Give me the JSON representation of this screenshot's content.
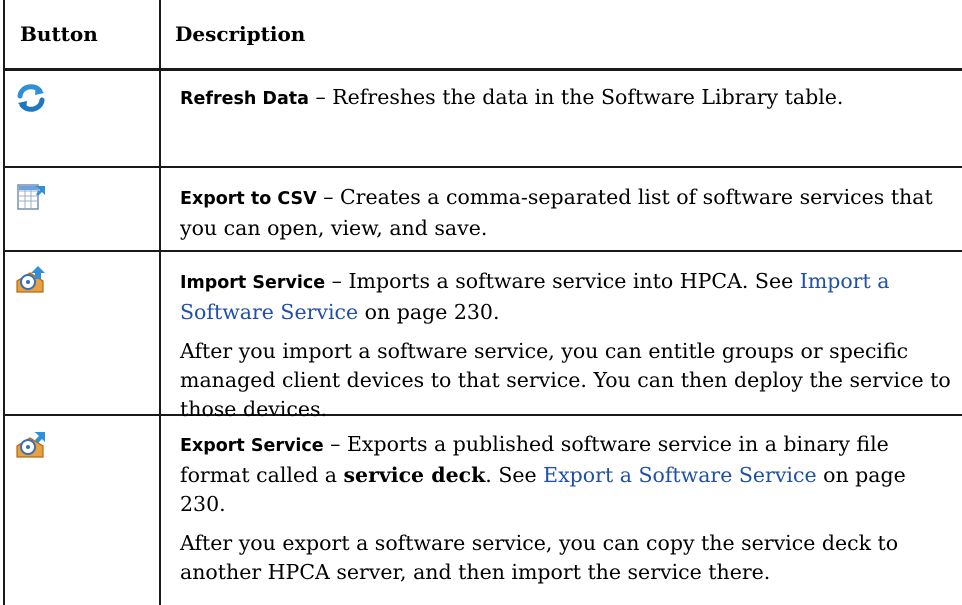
{
  "header": {
    "button": "Button",
    "description": "Description"
  },
  "rows": [
    {
      "icon": "refresh-icon",
      "term": "Refresh Data",
      "dash": " – ",
      "text": "Refreshes the data in the Software Library table."
    },
    {
      "icon": "export-csv-icon",
      "term": "Export to CSV",
      "dash": " – ",
      "text": "Creates a comma-separated list of software services that you can open, view, and save."
    },
    {
      "icon": "import-service-icon",
      "term": "Import Service",
      "dash": " – ",
      "text1": "Imports a software service into HPCA. See ",
      "link": "Import a Software Service",
      "text2": " on page 230.",
      "para2": "After you import a software service, you can entitle groups or specific managed client devices to that service. You can then deploy the service to those devices."
    },
    {
      "icon": "export-service-icon",
      "term": "Export Service",
      "dash": " – ",
      "text1": "Exports a published software service in a binary file format called a ",
      "strong": "service deck",
      "text2": ". See ",
      "link": "Export a Software Service",
      "text3": " on page 230.",
      "para2": "After you export a software service, you can copy the service deck to another HPCA server, and then import the service there."
    }
  ],
  "colors": {
    "link": "#1f4fa8",
    "rule": "#1a1a1a"
  }
}
